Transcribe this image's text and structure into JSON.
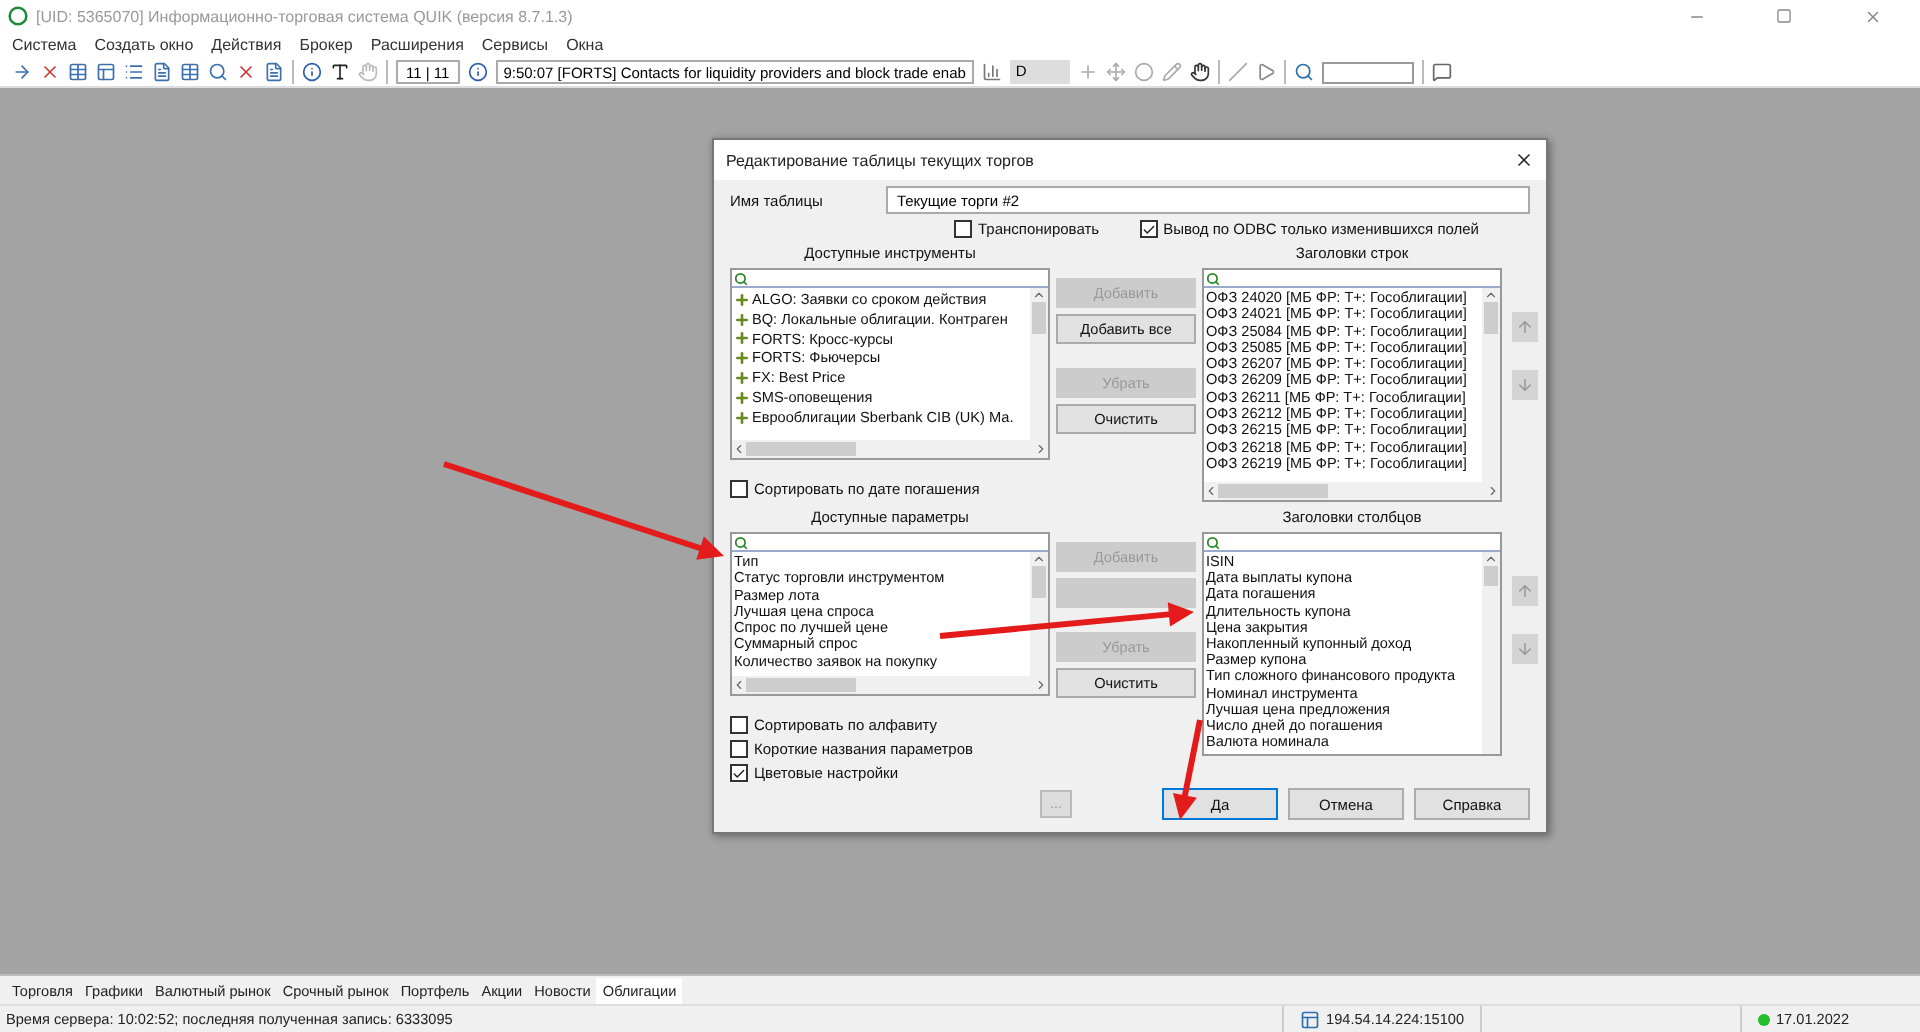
{
  "window": {
    "title": "[UID: 5365070] Информационно-торговая система QUIK (версия 8.7.1.3)"
  },
  "menu": [
    "Система",
    "Создать окно",
    "Действия",
    "Брокер",
    "Расширения",
    "Сервисы",
    "Окна"
  ],
  "toolbar": {
    "counter": "11 | 11",
    "message": "9:50:07  [FORTS] Contacts for liquidity providers and block trade enab",
    "interval": "D"
  },
  "dialog": {
    "title": "Редактирование таблицы текущих торгов",
    "table_name_label": "Имя таблицы",
    "table_name_value": "Текущие торги #2",
    "options": [
      {
        "label": "Транспонировать",
        "checked": false
      },
      {
        "label": "Вывод по ODBC только изменившихся  полей",
        "checked": true
      }
    ],
    "available_instruments": {
      "heading": "Доступные инструменты",
      "items": [
        "ALGO: Заявки со сроком действия",
        "BQ: Локальные облигации. Контраген",
        "FORTS: Кросс-курсы",
        "FORTS: Фьючерсы",
        "FX: Best Price",
        "SMS-оповещения",
        "Еврооблигации Sberbank CIB (UK) Ма."
      ]
    },
    "instrument_buttons": [
      {
        "label": "Добавить",
        "disabled": true
      },
      {
        "label": "Добавить все",
        "disabled": false
      },
      {
        "label": "Убрать",
        "disabled": true
      },
      {
        "label": "Очистить",
        "disabled": false
      }
    ],
    "row_headers": {
      "heading": "Заголовки строк",
      "items": [
        "ОФЗ 24020 [МБ ФР: Т+: Гособлигации]",
        "ОФЗ 24021 [МБ ФР: Т+: Гособлигации]",
        "ОФЗ 25084 [МБ ФР: Т+: Гособлигации]",
        "ОФЗ 25085 [МБ ФР: Т+: Гособлигации]",
        "ОФЗ 26207 [МБ ФР: Т+: Гособлигации]",
        "ОФЗ 26209 [МБ ФР: Т+: Гособлигации]",
        "ОФЗ 26211 [МБ ФР: Т+: Гособлигации]",
        "ОФЗ 26212 [МБ ФР: Т+: Гособлигации]",
        "ОФЗ 26215 [МБ ФР: Т+: Гособлигации]",
        "ОФЗ 26218 [МБ ФР: Т+: Гособлигации]",
        "ОФЗ 26219 [МБ ФР: Т+: Гособлигации]"
      ]
    },
    "sort_by_maturity": {
      "label": "Сортировать по дате погашения",
      "checked": false
    },
    "available_parameters": {
      "heading": "Доступные параметры",
      "items": [
        "Тип",
        "Статус торговли инструментом",
        "Размер лота",
        "Лучшая цена спроса",
        "Спрос по лучшей цене",
        "Суммарный спрос",
        "Количество заявок на покупку"
      ]
    },
    "parameter_buttons": [
      {
        "label": "Добавить",
        "disabled": true
      },
      {
        "disabled": true
      },
      {
        "label": "Убрать",
        "disabled": true
      },
      {
        "label": "Очистить",
        "disabled": false
      }
    ],
    "column_headers": {
      "heading": "Заголовки столбцов",
      "items": [
        "ISIN",
        "Дата выплаты купона",
        "Дата погашения",
        "Длительность купона",
        "Цена закрытия",
        "Накопленный купонный доход",
        "Размер купона",
        "Тип сложного финансового продукта",
        "Номинал инструмента",
        "Лучшая цена предложения",
        "Число дней до погашения",
        "Валюта номинала"
      ]
    },
    "parameter_options": [
      {
        "label": "Сортировать по алфавиту",
        "checked": false
      },
      {
        "label": "Короткие названия параметров",
        "checked": false
      },
      {
        "label": "Цветовые настройки",
        "checked": true
      }
    ],
    "more_button": "...",
    "footer_buttons": [
      {
        "label": "Да",
        "selected": true
      },
      {
        "label": "Отмена",
        "selected": false
      },
      {
        "label": "Справка",
        "selected": false
      }
    ]
  },
  "tabs": [
    {
      "label": "Торговля",
      "selected": false
    },
    {
      "label": "Графики",
      "selected": false
    },
    {
      "label": "Валютный рынок",
      "selected": false
    },
    {
      "label": "Срочный рынок",
      "selected": false
    },
    {
      "label": "Портфель",
      "selected": false
    },
    {
      "label": "Акции",
      "selected": false
    },
    {
      "label": "Новости",
      "selected": false
    },
    {
      "label": "Облигации",
      "selected": true
    }
  ],
  "status_bar": {
    "server_info": "Время сервера: 10:02:52; последняя полученная запись: 6333095",
    "address": "194.54.14.224:15100",
    "date": "17.01.2022"
  }
}
